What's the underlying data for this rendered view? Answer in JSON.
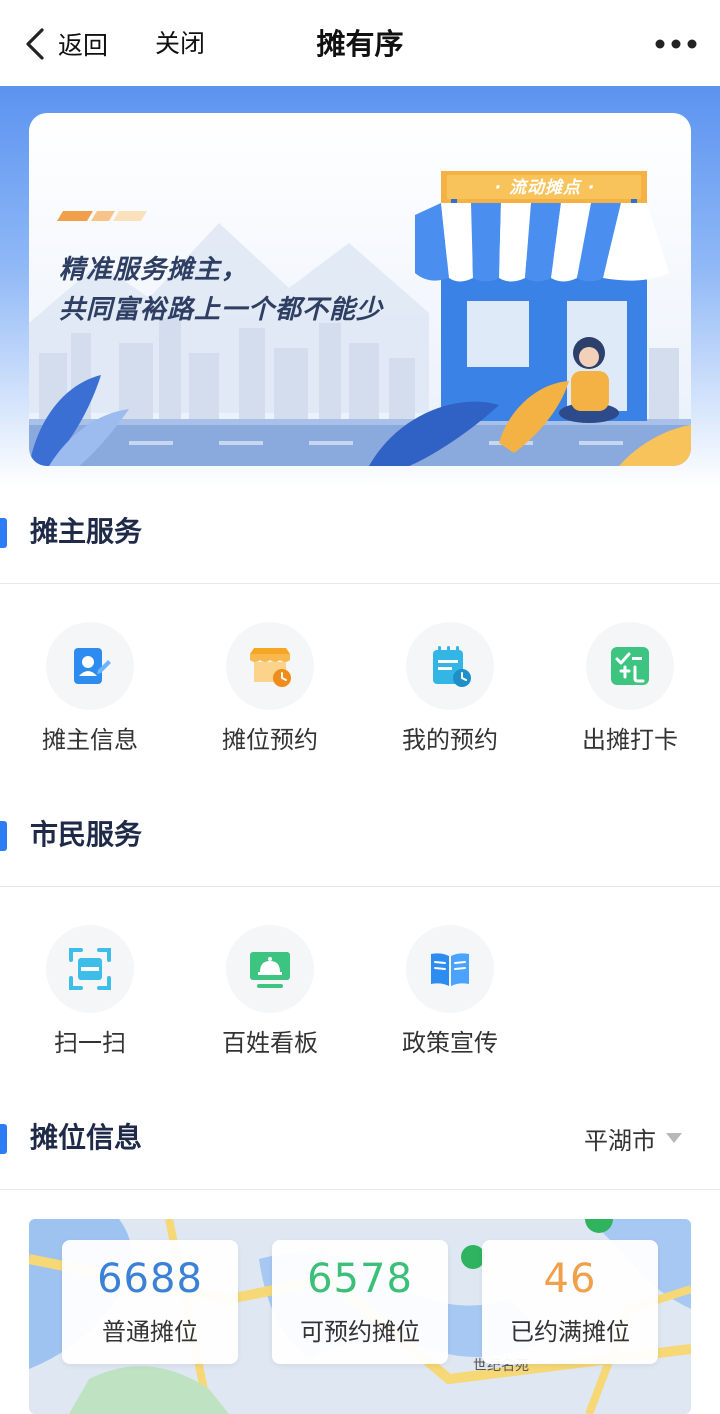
{
  "navbar": {
    "back_label": "返回",
    "close_label": "关闭",
    "title": "摊有序"
  },
  "banner": {
    "line1": "精准服务摊主，",
    "line2": "共同富裕路上一个都不能少",
    "sign_text": "· 流动摊点 ·"
  },
  "vendor_services": {
    "title": "摊主服务",
    "items": [
      {
        "label": "摊主信息",
        "icon": "vendor-profile-icon",
        "color": "#2d8cf0"
      },
      {
        "label": "摊位预约",
        "icon": "stall-booking-icon",
        "color": "#f5a623"
      },
      {
        "label": "我的预约",
        "icon": "my-booking-icon",
        "color": "#33b5e5"
      },
      {
        "label": "出摊打卡",
        "icon": "checkin-icon",
        "color": "#3cc480"
      }
    ]
  },
  "citizen_services": {
    "title": "市民服务",
    "items": [
      {
        "label": "扫一扫",
        "icon": "scan-icon",
        "color": "#3dbde8"
      },
      {
        "label": "百姓看板",
        "icon": "dashboard-icon",
        "color": "#3cc480"
      },
      {
        "label": "政策宣传",
        "icon": "policy-book-icon",
        "color": "#2d8cf0"
      }
    ]
  },
  "stall_info": {
    "title": "摊位信息",
    "region": "平湖市",
    "map_label": "世纪名苑",
    "stats": [
      {
        "value": "6688",
        "label": "普通摊位",
        "color": "#3b82d6"
      },
      {
        "value": "6578",
        "label": "可预约摊位",
        "color": "#3cbf78"
      },
      {
        "value": "46",
        "label": "已约满摊位",
        "color": "#f0a04a"
      }
    ]
  }
}
